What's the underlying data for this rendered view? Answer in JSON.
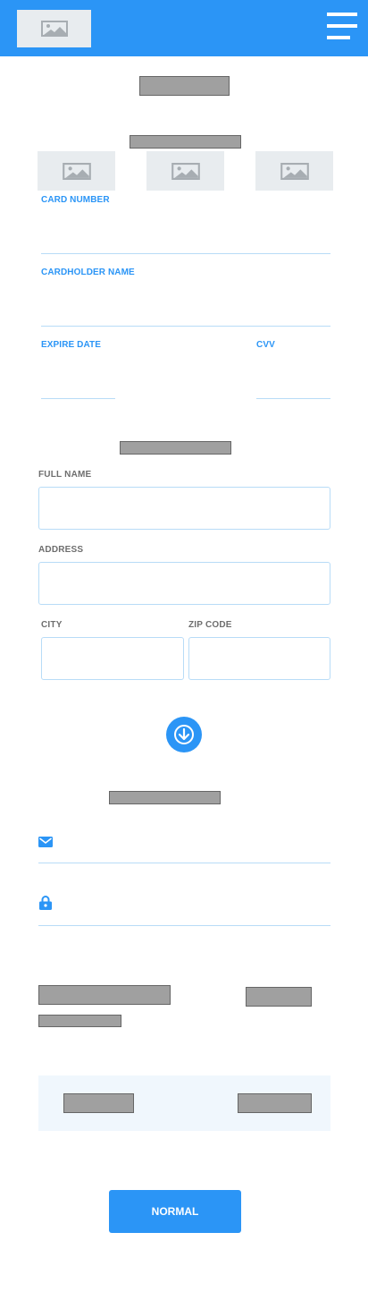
{
  "header": {
    "logo_icon": "image-placeholder-icon",
    "menu_icon": "hamburger-menu-icon"
  },
  "card_form": {
    "card_number_label": "CARD NUMBER",
    "cardholder_name_label": "CARDHOLDER NAME",
    "expire_date_label": "EXPIRE DATE",
    "cvv_label": "CVV",
    "card_logo_icons": [
      "image-placeholder-icon",
      "image-placeholder-icon",
      "image-placeholder-icon"
    ]
  },
  "address_form": {
    "full_name_label": "FULL NAME",
    "address_label": "ADDRESS",
    "city_label": "CITY",
    "zip_code_label": "ZIP CODE"
  },
  "scroll_button": {
    "icon": "arrow-down-icon"
  },
  "login_form": {
    "email_icon": "envelope-icon",
    "password_icon": "lock-icon"
  },
  "primary_button": {
    "label": "NORMAL"
  },
  "colors": {
    "accent": "#2b95f6",
    "placeholder_block": "#a0a0a0",
    "image_placeholder_bg": "#e8ecef",
    "field_border": "#b8dcf7",
    "panel_bg": "#f0f7fd"
  }
}
